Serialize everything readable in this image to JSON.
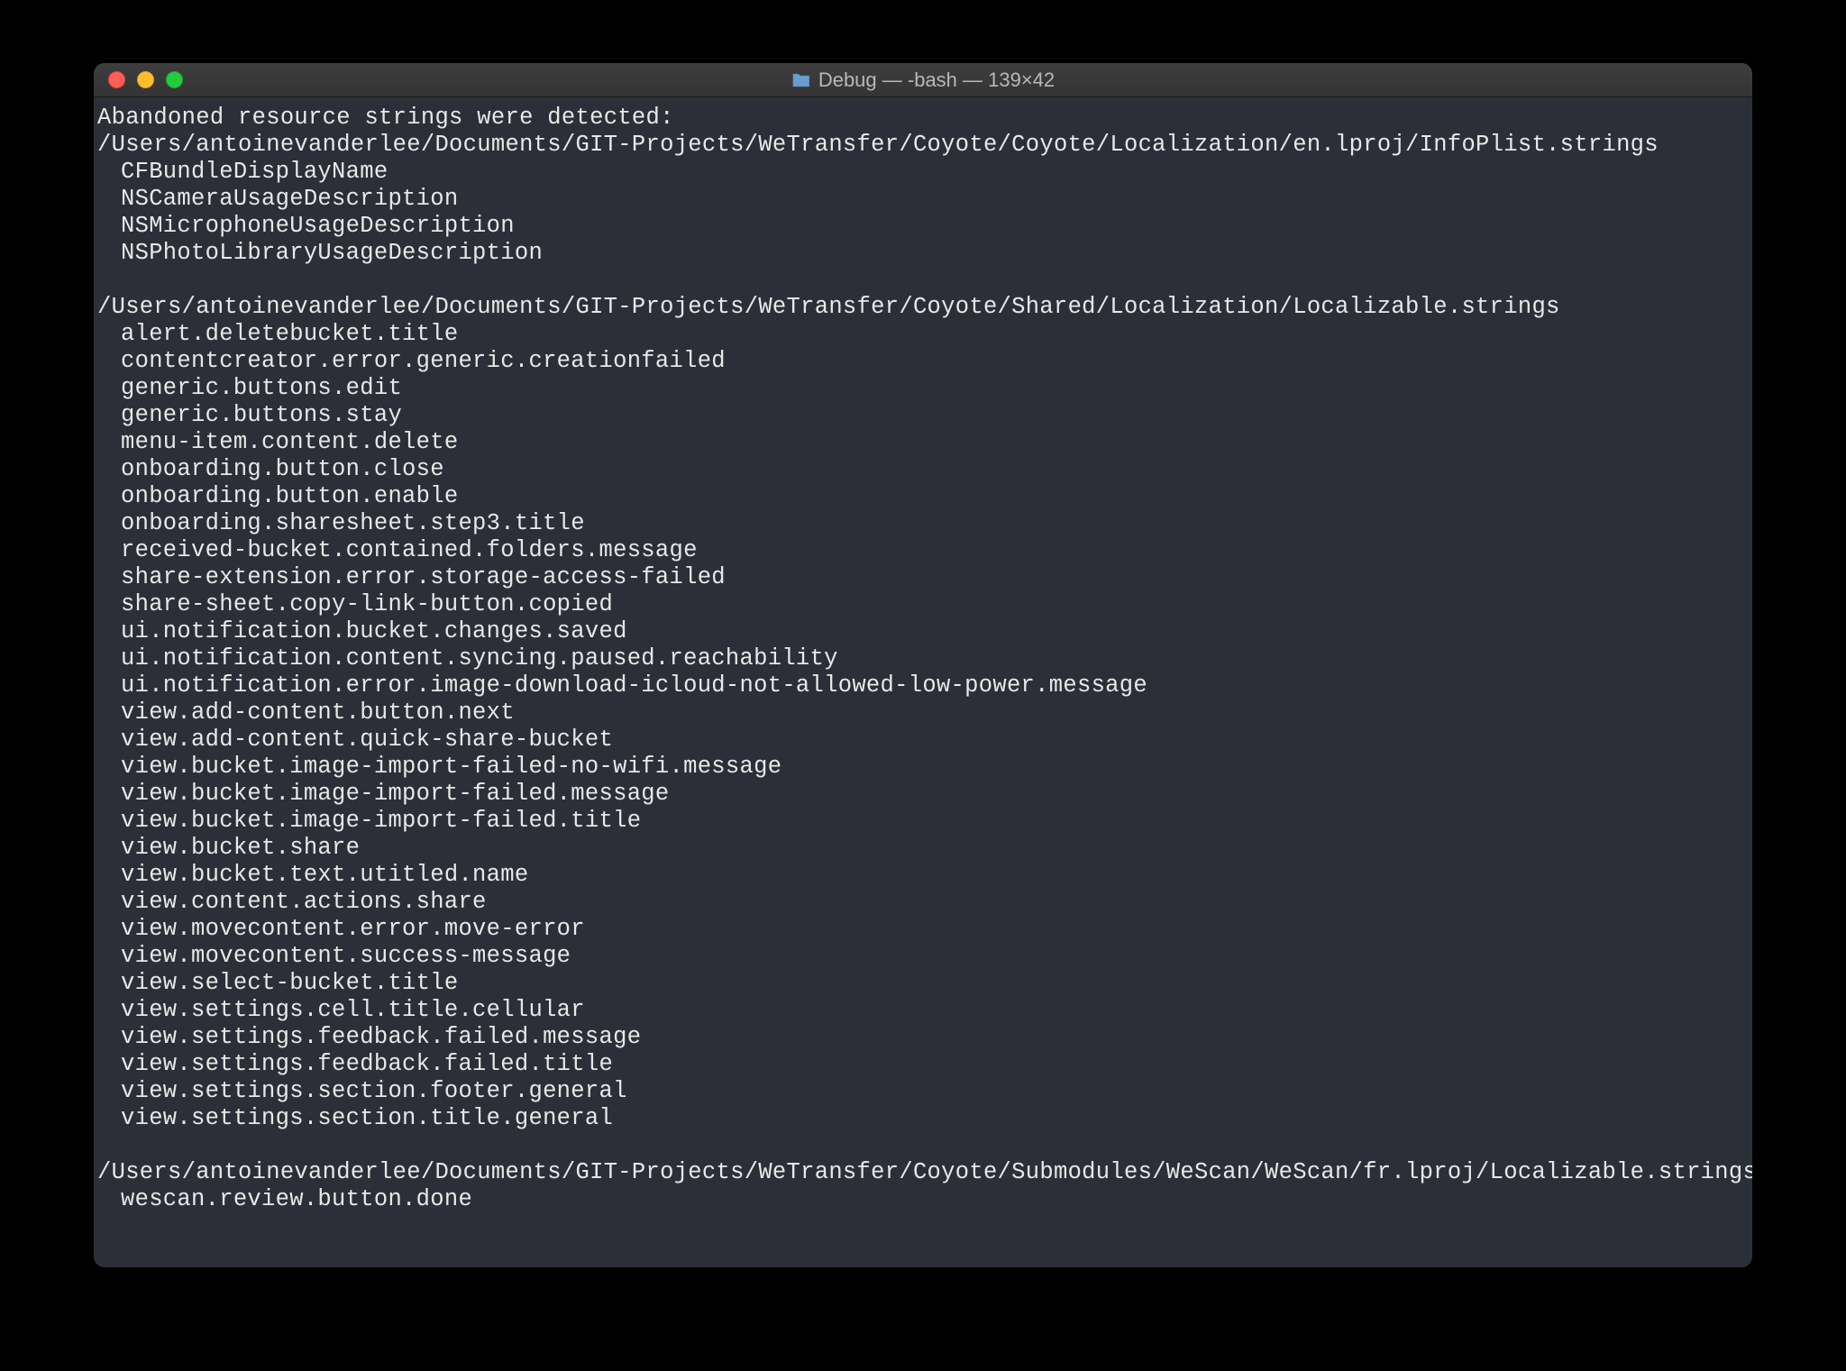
{
  "window": {
    "title": "Debug — -bash — 139×42",
    "folder_icon": "📁"
  },
  "output": {
    "header": "Abandoned resource strings were detected:",
    "sections": [
      {
        "path": "/Users/antoinevanderlee/Documents/GIT-Projects/WeTransfer/Coyote/Coyote/Localization/en.lproj/InfoPlist.strings",
        "keys": [
          "CFBundleDisplayName",
          "NSCameraUsageDescription",
          "NSMicrophoneUsageDescription",
          "NSPhotoLibraryUsageDescription"
        ]
      },
      {
        "path": "/Users/antoinevanderlee/Documents/GIT-Projects/WeTransfer/Coyote/Shared/Localization/Localizable.strings",
        "keys": [
          "alert.deletebucket.title",
          "contentcreator.error.generic.creationfailed",
          "generic.buttons.edit",
          "generic.buttons.stay",
          "menu-item.content.delete",
          "onboarding.button.close",
          "onboarding.button.enable",
          "onboarding.sharesheet.step3.title",
          "received-bucket.contained.folders.message",
          "share-extension.error.storage-access-failed",
          "share-sheet.copy-link-button.copied",
          "ui.notification.bucket.changes.saved",
          "ui.notification.content.syncing.paused.reachability",
          "ui.notification.error.image-download-icloud-not-allowed-low-power.message",
          "view.add-content.button.next",
          "view.add-content.quick-share-bucket",
          "view.bucket.image-import-failed-no-wifi.message",
          "view.bucket.image-import-failed.message",
          "view.bucket.image-import-failed.title",
          "view.bucket.share",
          "view.bucket.text.utitled.name",
          "view.content.actions.share",
          "view.movecontent.error.move-error",
          "view.movecontent.success-message",
          "view.select-bucket.title",
          "view.settings.cell.title.cellular",
          "view.settings.feedback.failed.message",
          "view.settings.feedback.failed.title",
          "view.settings.section.footer.general",
          "view.settings.section.title.general"
        ]
      },
      {
        "path": "/Users/antoinevanderlee/Documents/GIT-Projects/WeTransfer/Coyote/Submodules/WeScan/WeScan/fr.lproj/Localizable.strings",
        "keys": [
          "wescan.review.button.done"
        ]
      }
    ]
  }
}
